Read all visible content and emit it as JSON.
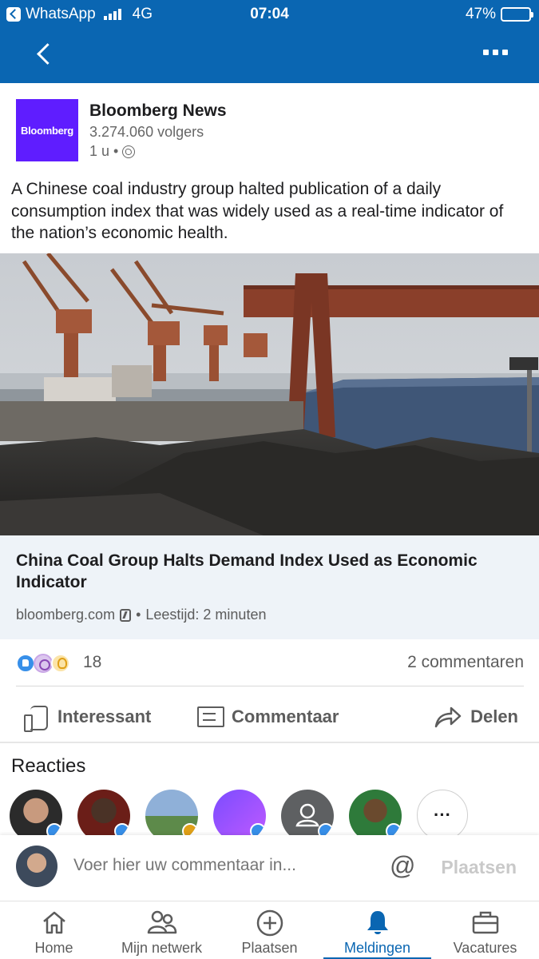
{
  "status_bar": {
    "carrier_app": "WhatsApp",
    "network": "4G",
    "time": "07:04",
    "battery_percent": "47%",
    "battery_level": 0.47
  },
  "post": {
    "author": "Bloomberg News",
    "logo_text": "Bloomberg",
    "followers": "3.274.060 volgers",
    "age": "1 u",
    "text": "A Chinese coal industry group halted publication of a daily consumption index that was widely used as a real-time indicator of the nation’s economic health.",
    "article": {
      "title": "China Coal Group Halts Demand Index Used as Economic Indicator",
      "source": "bloomberg.com",
      "read_time": "Leestijd: 2 minuten"
    },
    "reaction_count": "18",
    "comment_count": "2 commentaren"
  },
  "actions": {
    "like": "Interessant",
    "comment": "Commentaar",
    "share": "Delen"
  },
  "reacties": {
    "title": "Reacties",
    "more": "···"
  },
  "comment_box": {
    "placeholder": "Voer hier uw commentaar in...",
    "mention": "@",
    "post_button": "Plaatsen"
  },
  "tabs": [
    {
      "label": "Home",
      "icon": "home-icon"
    },
    {
      "label": "Mijn netwerk",
      "icon": "network-icon"
    },
    {
      "label": "Plaatsen",
      "icon": "plus-circle-icon"
    },
    {
      "label": "Meldingen",
      "icon": "bell-icon",
      "active": true
    },
    {
      "label": "Vacatures",
      "icon": "briefcase-icon"
    }
  ],
  "colors": {
    "brand_blue": "#0a66b2",
    "bloomberg_purple": "#5f1dff",
    "article_card_bg": "#eef3f8"
  }
}
